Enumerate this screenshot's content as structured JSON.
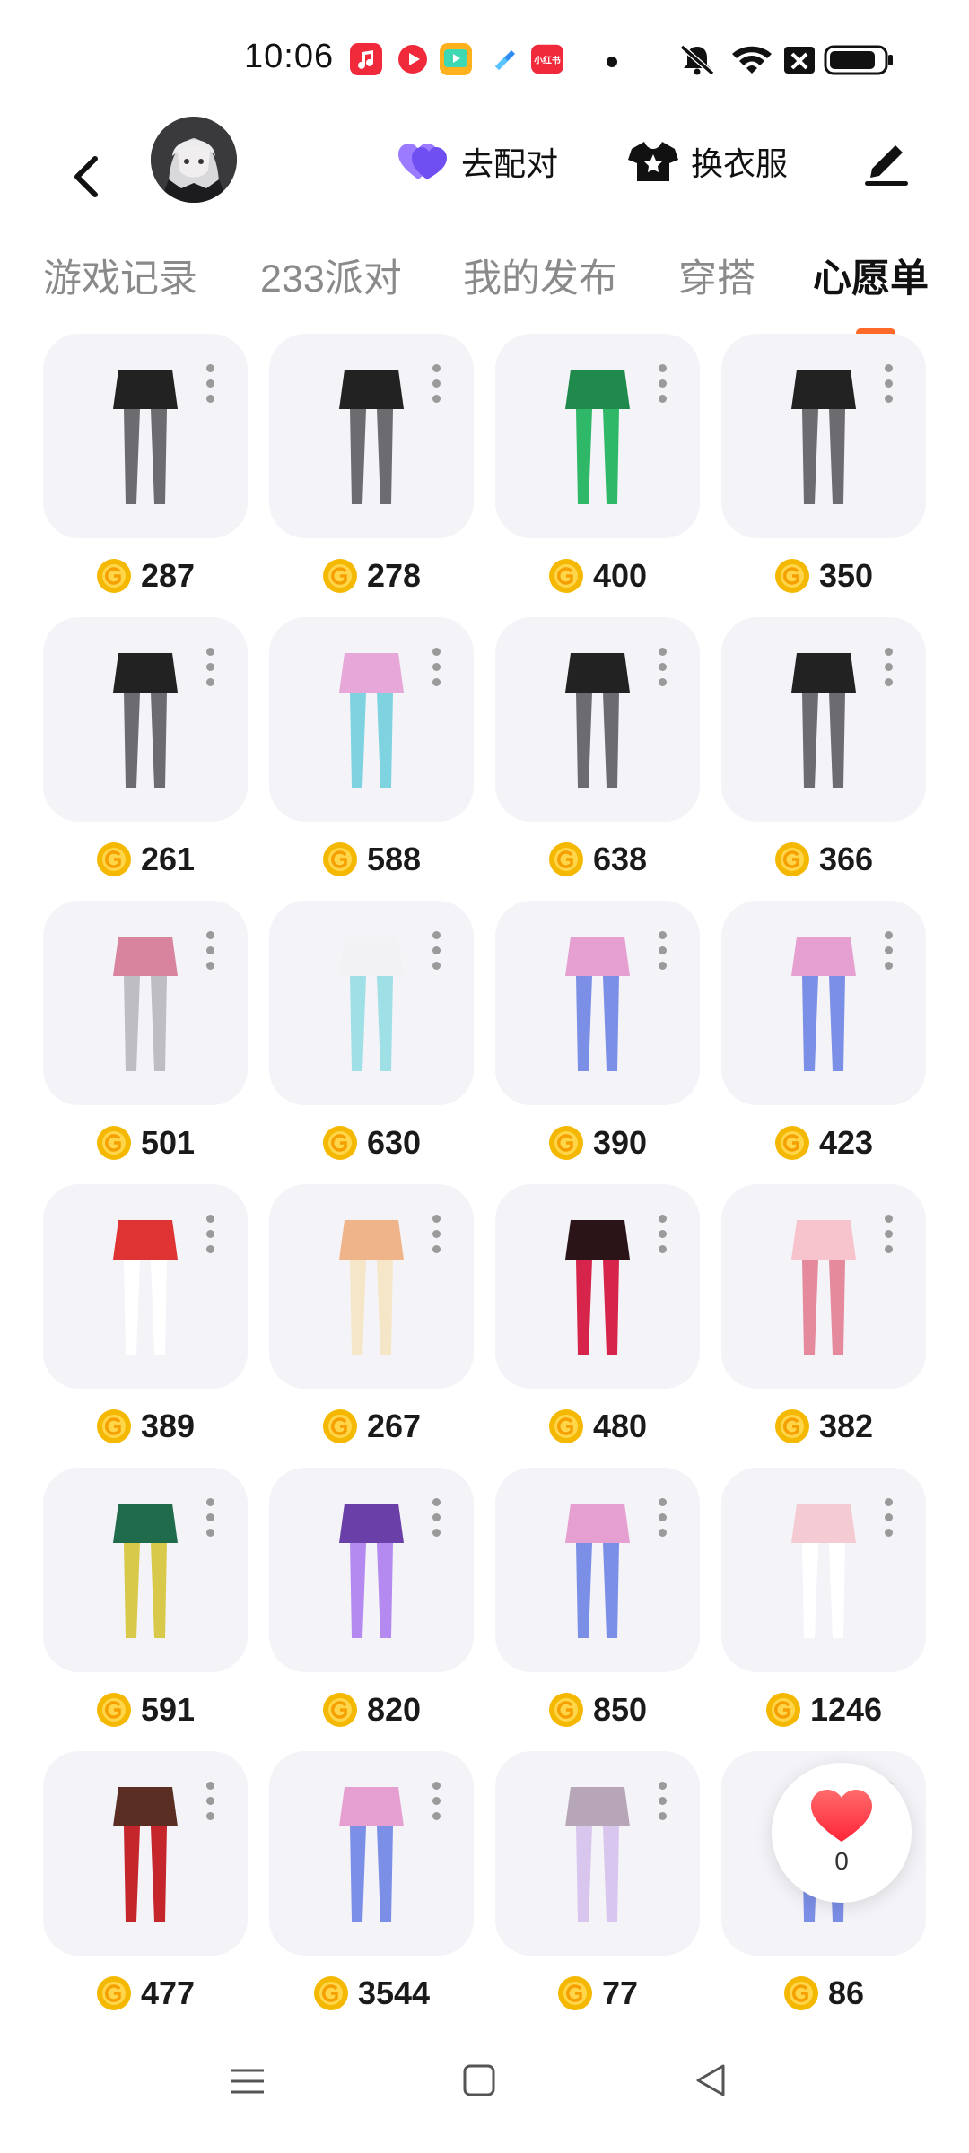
{
  "status_bar": {
    "time": "10:06",
    "notification_icons": [
      "music-app-icon",
      "video-app-icon",
      "media-app-icon",
      "browser-app-icon",
      "xiaohongshu-app-icon"
    ],
    "xiaohongshu_label": "小红书",
    "system_icons": [
      "mute-icon",
      "wifi-icon",
      "sim-off-icon",
      "battery-icon"
    ]
  },
  "header": {
    "back_icon": "chevron-left-icon",
    "pair_label": "去配对",
    "dress_label": "换衣服",
    "edit_icon": "pen-icon"
  },
  "tabs": [
    {
      "label": "游戏记录",
      "active": false
    },
    {
      "label": "233派对",
      "active": false
    },
    {
      "label": "我的发布",
      "active": false
    },
    {
      "label": "穿搭",
      "active": false
    },
    {
      "label": "心愿单",
      "active": true
    }
  ],
  "colors": {
    "accent": "#ff6a2b",
    "coin": "#f5b800",
    "card_bg": "#f4f4f8",
    "heart": "#ff3b4a",
    "pair_heart": "#7b5cf5"
  },
  "items": [
    {
      "price": "287",
      "icon": "skirt-stockings-icon"
    },
    {
      "price": "278",
      "icon": "skirt-stockings-icon"
    },
    {
      "price": "400",
      "icon": "green-dress-icon"
    },
    {
      "price": "350",
      "icon": "skirt-stockings-icon"
    },
    {
      "price": "261",
      "icon": "skirt-stockings-icon"
    },
    {
      "price": "588",
      "icon": "boots-icon"
    },
    {
      "price": "638",
      "icon": "skirt-stockings-icon"
    },
    {
      "price": "366",
      "icon": "skirt-stockings-icon"
    },
    {
      "price": "501",
      "icon": "plaid-skirt-icon"
    },
    {
      "price": "630",
      "icon": "shorts-stockings-icon"
    },
    {
      "price": "390",
      "icon": "outfit-icon"
    },
    {
      "price": "423",
      "icon": "outfit-icon"
    },
    {
      "price": "389",
      "icon": "maid-dress-icon"
    },
    {
      "price": "267",
      "icon": "costume-icon"
    },
    {
      "price": "480",
      "icon": "gothic-dress-icon"
    },
    {
      "price": "382",
      "icon": "pink-dress-icon"
    },
    {
      "price": "591",
      "icon": "ribbon-accessory-icon"
    },
    {
      "price": "820",
      "icon": "purple-outfit-icon"
    },
    {
      "price": "850",
      "icon": "outfit-icon"
    },
    {
      "price": "1246",
      "icon": "hoodie-icon"
    },
    {
      "price": "477",
      "icon": "hairstyle-icon"
    },
    {
      "price": "3544",
      "icon": "outfit-icon"
    },
    {
      "price": "77",
      "icon": "hair-accessory-icon"
    },
    {
      "price": "86",
      "icon": "outfit-icon"
    }
  ],
  "like_fab": {
    "count": "0",
    "icon": "heart-icon"
  },
  "navbar": {
    "items": [
      "menu-icon",
      "home-square-icon",
      "back-triangle-icon"
    ]
  }
}
